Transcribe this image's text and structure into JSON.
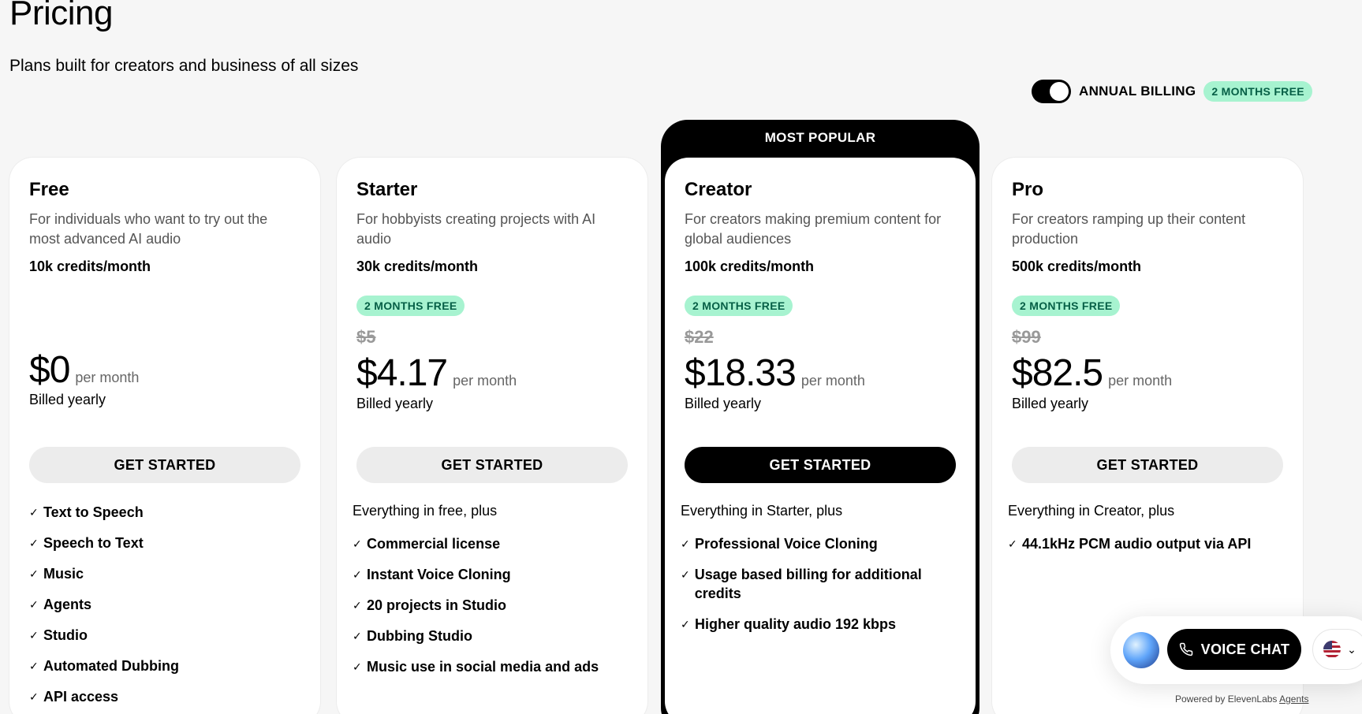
{
  "header": {
    "title": "Pricing",
    "subtitle": "Plans built for creators and business of all sizes"
  },
  "billing": {
    "label": "ANNUAL BILLING",
    "badge": "2 MONTHS FREE",
    "annual_enabled": true
  },
  "popular_label": "MOST POPULAR",
  "plans": [
    {
      "name": "Free",
      "description": "For individuals who want to try out the most advanced AI audio",
      "credits": "10k credits/month",
      "badge": "",
      "old_price": "",
      "price": "$0",
      "per": "per month",
      "billed": "Billed yearly",
      "cta": "GET STARTED",
      "intro": "",
      "features": [
        "Text to Speech",
        "Speech to Text",
        "Music",
        "Agents",
        "Studio",
        "Automated Dubbing",
        "API access"
      ]
    },
    {
      "name": "Starter",
      "description": "For hobbyists creating projects with AI audio",
      "credits": "30k credits/month",
      "badge": "2 MONTHS FREE",
      "old_price": "$5",
      "price": "$4.17",
      "per": "per month",
      "billed": "Billed yearly",
      "cta": "GET STARTED",
      "intro": "Everything in free, plus",
      "features": [
        "Commercial license",
        "Instant Voice Cloning",
        "20 projects in Studio",
        "Dubbing Studio",
        "Music use in social media and ads"
      ]
    },
    {
      "name": "Creator",
      "description": "For creators making premium content for global audiences",
      "credits": "100k credits/month",
      "badge": "2 MONTHS FREE",
      "old_price": "$22",
      "price": "$18.33",
      "per": "per month",
      "billed": "Billed yearly",
      "cta": "GET STARTED",
      "intro": "Everything in Starter, plus",
      "features": [
        "Professional Voice Cloning",
        "Usage based billing for additional credits",
        "Higher quality audio 192 kbps"
      ]
    },
    {
      "name": "Pro",
      "description": "For creators ramping up their content production",
      "credits": "500k credits/month",
      "badge": "2 MONTHS FREE",
      "old_price": "$99",
      "price": "$82.5",
      "per": "per month",
      "billed": "Billed yearly",
      "cta": "GET STARTED",
      "intro": "Everything in Creator, plus",
      "features": [
        "44.1kHz PCM audio output via API"
      ]
    }
  ],
  "widget": {
    "voice_chat_label": "VOICE CHAT",
    "powered_by": "Powered by ElevenLabs",
    "powered_link": "Agents"
  },
  "icons": {
    "check": "check-icon",
    "phone": "phone-icon",
    "flag": "us-flag-icon",
    "chevron": "chevron-down-icon"
  },
  "colors": {
    "badge_bg": "#a7f3d0",
    "badge_text": "#065f46",
    "accent": "#000000"
  }
}
